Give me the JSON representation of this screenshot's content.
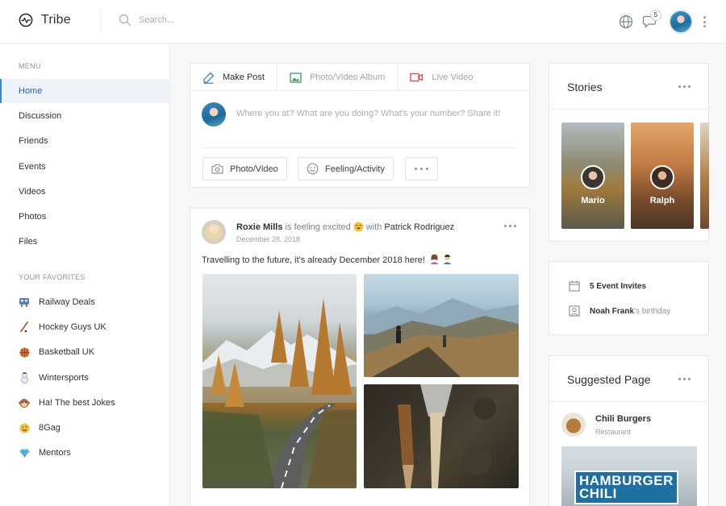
{
  "app": {
    "name": "Tribe"
  },
  "header": {
    "search_placeholder": "Search...",
    "notification_count": "5"
  },
  "sidebar": {
    "menu_heading": "MENU",
    "items": [
      {
        "label": "Home",
        "active": true
      },
      {
        "label": "Discussion"
      },
      {
        "label": "Friends"
      },
      {
        "label": "Events"
      },
      {
        "label": "Videos"
      },
      {
        "label": "Photos"
      },
      {
        "label": "Files"
      }
    ],
    "favorites_heading": "YOUR FAVORITES",
    "favorites": [
      {
        "label": "Railway Deals",
        "icon": "train-icon"
      },
      {
        "label": "Hockey Guys UK",
        "icon": "hockey-stick-icon"
      },
      {
        "label": "Basketball UK",
        "icon": "basketball-icon"
      },
      {
        "label": "Wintersports",
        "icon": "snowman-icon"
      },
      {
        "label": "Ha! The best Jokes",
        "icon": "monkey-icon"
      },
      {
        "label": "8Gag",
        "icon": "tongue-face-icon"
      },
      {
        "label": "Mentors",
        "icon": "diamond-icon"
      }
    ]
  },
  "composer": {
    "tabs": [
      {
        "label": "Make Post",
        "active": true
      },
      {
        "label": "Photo/Video Album"
      },
      {
        "label": "Live Video"
      }
    ],
    "placeholder": "Where you at? What are you doing? What's your number? Share it!",
    "actions": [
      {
        "label": "Photo/Video"
      },
      {
        "label": "Feeling/Activity"
      }
    ]
  },
  "post": {
    "author": "Roxie Mills",
    "status": "is feeling excited",
    "with_word": "with",
    "tagged": "Patrick Rodriguez",
    "date": "December 28, 2018",
    "text": "Travelling to the future, it's already December 2018 here!"
  },
  "stories": {
    "title": "Stories",
    "items": [
      {
        "name": "Mario"
      },
      {
        "name": "Ralph"
      }
    ]
  },
  "events": {
    "invites_count": "5",
    "invites_label": "Event Invites",
    "birthday_name": "Noah Frank",
    "birthday_suffix": "'s birthday"
  },
  "suggested": {
    "title": "Suggested Page",
    "page_name": "Chili Burgers",
    "page_type": "Restaurant",
    "sign_text_1": "HAMBURGER",
    "sign_text_2": "CHILI"
  },
  "colors": {
    "accent": "#3b82d6",
    "live": "#e04b3a",
    "photo": "#3d9a5a"
  }
}
